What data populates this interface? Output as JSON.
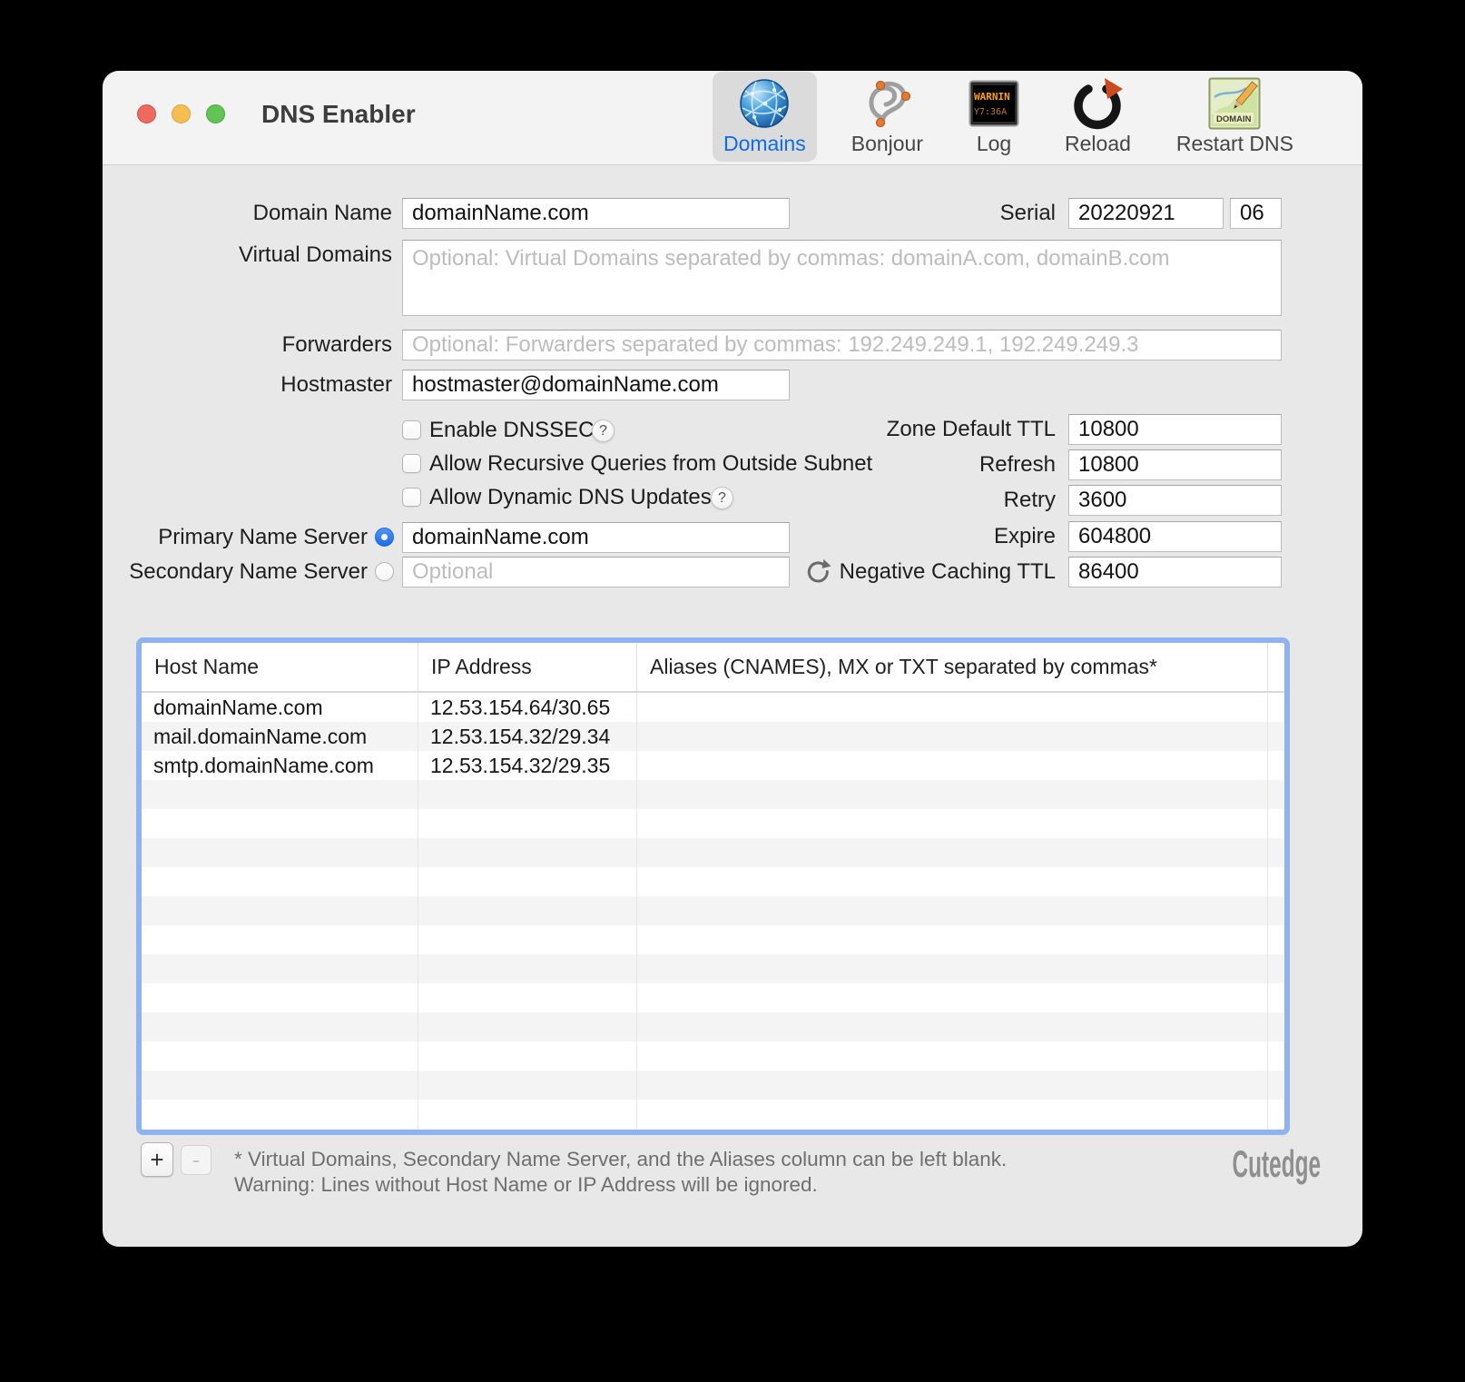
{
  "window": {
    "title": "DNS Enabler"
  },
  "toolbar": {
    "items": [
      {
        "label": "Domains",
        "selected": true
      },
      {
        "label": "Bonjour",
        "selected": false
      },
      {
        "label": "Log",
        "selected": false
      },
      {
        "label": "Reload",
        "selected": false
      },
      {
        "label": "Restart DNS",
        "selected": false
      }
    ]
  },
  "form": {
    "help_symbol": "?",
    "domain_name": {
      "label": "Domain Name",
      "value": "domainName.com"
    },
    "serial": {
      "label": "Serial",
      "value": "20220921",
      "suffix": "06"
    },
    "virtual_domains": {
      "label": "Virtual Domains",
      "placeholder": "Optional: Virtual Domains separated by commas: domainA.com, domainB.com"
    },
    "forwarders": {
      "label": "Forwarders",
      "placeholder": "Optional: Forwarders separated by commas: 192.249.249.1, 192.249.249.3"
    },
    "hostmaster": {
      "label": "Hostmaster",
      "value": "hostmaster@domainName.com"
    },
    "checkboxes": [
      {
        "label": "Enable DNSSEC",
        "checked": false,
        "has_help": true
      },
      {
        "label": "Allow Recursive Queries from Outside Subnet",
        "checked": false,
        "has_help": false
      },
      {
        "label": "Allow Dynamic DNS Updates",
        "checked": false,
        "has_help": true
      }
    ],
    "primary_ns": {
      "label": "Primary Name Server",
      "value": "domainName.com",
      "selected": true
    },
    "secondary_ns": {
      "label": "Secondary Name Server",
      "placeholder": "Optional",
      "selected": false
    },
    "timers": [
      {
        "label": "Zone Default TTL",
        "value": "10800"
      },
      {
        "label": "Refresh",
        "value": "10800"
      },
      {
        "label": "Retry",
        "value": "3600"
      },
      {
        "label": "Expire",
        "value": "604800"
      },
      {
        "label": "Negative Caching TTL",
        "value": "86400"
      }
    ]
  },
  "table": {
    "columns": [
      "Host Name",
      "IP Address",
      "Aliases (CNAMES), MX or TXT separated by commas*"
    ],
    "rows": [
      {
        "host": "domainName.com",
        "ip": "12.53.154.64/30.65",
        "aliases": ""
      },
      {
        "host": "mail.domainName.com",
        "ip": "12.53.154.32/29.34",
        "aliases": ""
      },
      {
        "host": "smtp.domainName.com",
        "ip": "12.53.154.32/29.35",
        "aliases": ""
      }
    ],
    "empty_row_count": 12
  },
  "footer": {
    "add_label": "+",
    "remove_label": "-",
    "note_line1": "* Virtual Domains, Secondary Name Server, and the Aliases column can be left blank.",
    "note_line2": "Warning: Lines without Host Name or IP Address will be ignored.",
    "brand": "Cutedge"
  },
  "colors": {
    "accent_blue": "#0f6be8",
    "focus_ring": "#8fb2f0",
    "radio_selected": "#1c6cf0",
    "traffic_red": "#ed6a5e",
    "traffic_yellow": "#f4bf4f",
    "traffic_green": "#61c555"
  }
}
